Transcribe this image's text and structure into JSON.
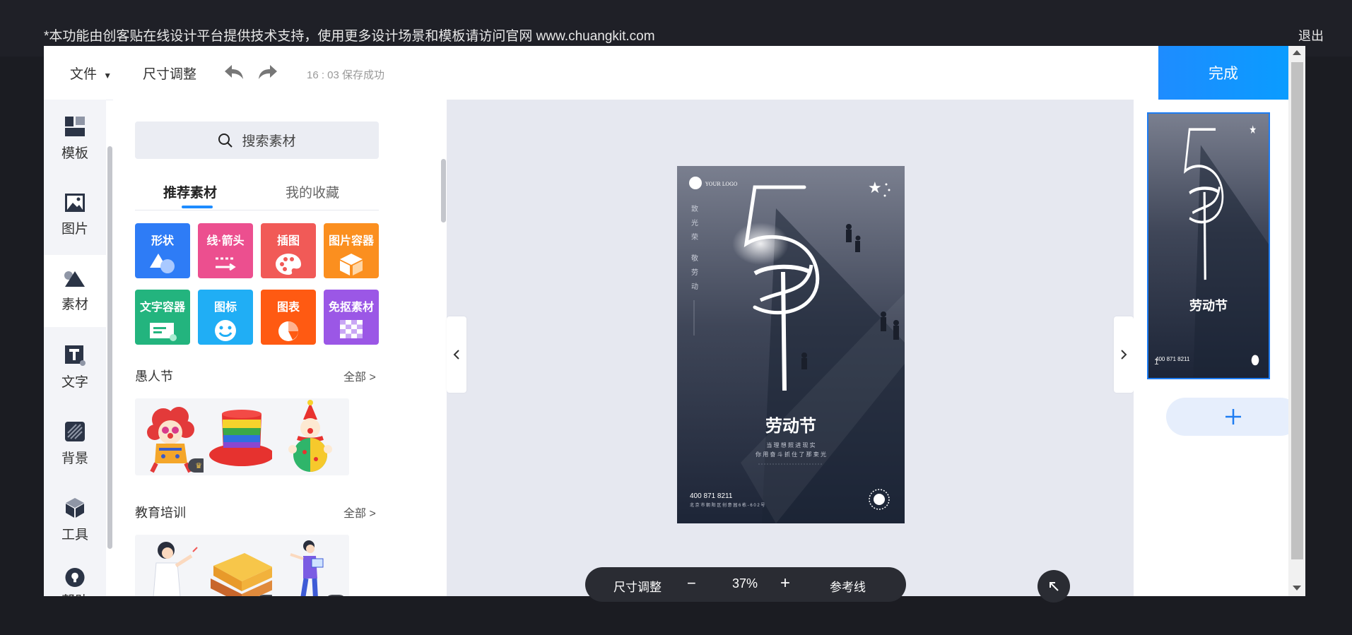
{
  "notice": "*本功能由创客贴在线设计平台提供技术支持，使用更多设计场景和模板请访问官网 www.chuangkit.com",
  "exit_label": "退出",
  "toolbar": {
    "file_label": "文件",
    "resize_label": "尺寸调整",
    "save_status": "16 : 03 保存成功",
    "done_label": "完成"
  },
  "sidebar": {
    "items": [
      {
        "label": "模板",
        "icon": "template-icon"
      },
      {
        "label": "图片",
        "icon": "image-icon"
      },
      {
        "label": "素材",
        "icon": "material-icon"
      },
      {
        "label": "文字",
        "icon": "text-icon"
      },
      {
        "label": "背景",
        "icon": "background-icon"
      },
      {
        "label": "工具",
        "icon": "tool-icon"
      },
      {
        "label": "帮助",
        "icon": "help-icon"
      }
    ],
    "active": "素材"
  },
  "panel": {
    "search_label": "搜索素材",
    "tabs": [
      "推荐素材",
      "我的收藏"
    ],
    "categories": [
      {
        "label": "形状",
        "color": "#2e7cf6"
      },
      {
        "label": "线·箭头",
        "color": "#ec4f8f"
      },
      {
        "label": "插图",
        "color": "#f15a57"
      },
      {
        "label": "图片容器",
        "color": "#fb8f1f"
      },
      {
        "label": "文字容器",
        "color": "#23b47e"
      },
      {
        "label": "图标",
        "color": "#20aef5"
      },
      {
        "label": "图表",
        "color": "#ff5a12"
      },
      {
        "label": "免抠素材",
        "color": "#9b57e6"
      }
    ],
    "sections": [
      {
        "title": "愚人节",
        "all_label": "全部 >"
      },
      {
        "title": "教育培训",
        "all_label": "全部 >"
      }
    ]
  },
  "poster": {
    "logo_text": "YOUR LOGO",
    "big_number": "5",
    "vertical_text": [
      "致",
      "光",
      "荣",
      "",
      "敬",
      "劳",
      "动"
    ],
    "title": "劳动节",
    "subtitle_line1": "当 理 想 照 进 现 实",
    "subtitle_line2": "你 用 奋 斗 抓 住 了 那 束 光",
    "phone": "400 871 8211",
    "address": "北 京 市 朝 阳 区 创 意 园 6 栋 - 6 0 2 号"
  },
  "zoombar": {
    "resize_label": "尺寸调整",
    "minus": "−",
    "zoom_value": "37%",
    "plus": "+",
    "guides_label": "参考线"
  },
  "pages": {
    "current_page": "1",
    "add_label": "+"
  }
}
